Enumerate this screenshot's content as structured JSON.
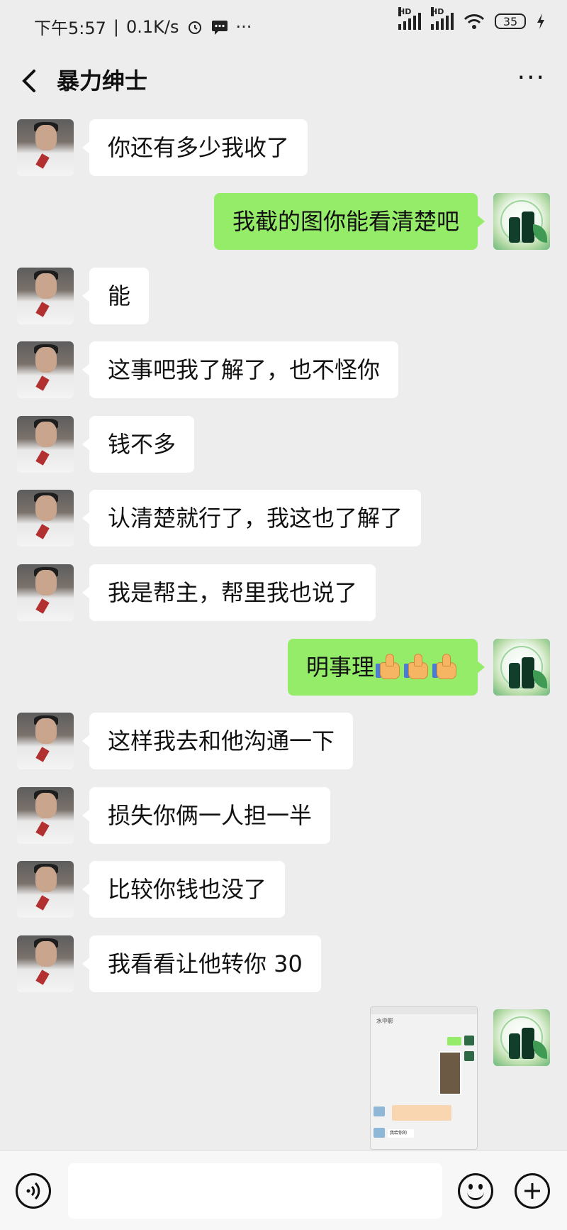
{
  "status_bar": {
    "time": "下午5:57",
    "speed": "0.1K/s",
    "more": "···",
    "network_label": "HD",
    "battery": "35"
  },
  "header": {
    "title": "暴力绅士",
    "more": "···"
  },
  "messages": [
    {
      "from": "them",
      "text": "你还有多少我收了"
    },
    {
      "from": "me",
      "text": "我截的图你能看清楚吧"
    },
    {
      "from": "them",
      "text": "能"
    },
    {
      "from": "them",
      "text": "这事吧我了解了，也不怪你"
    },
    {
      "from": "them",
      "text": "钱不多"
    },
    {
      "from": "them",
      "text": "认清楚就行了，我这也了解了"
    },
    {
      "from": "them",
      "text": "我是帮主，帮里我也说了"
    },
    {
      "from": "me",
      "text": "明事理",
      "emoji": "thumbs-up",
      "emoji_count": 3
    },
    {
      "from": "them",
      "text": "这样我去和他沟通一下"
    },
    {
      "from": "them",
      "text": "损失你俩一人担一半"
    },
    {
      "from": "them",
      "text": "比较你钱也没了"
    },
    {
      "from": "them",
      "text": "我看看让他转你 30"
    },
    {
      "from": "me",
      "type": "image",
      "description_icon": "screenshot-thumbnail"
    }
  ],
  "shot": {
    "header": "水中影",
    "tag": "我给你的"
  },
  "input": {
    "value": "",
    "placeholder": ""
  },
  "icons": {
    "back": "chevron-left-icon",
    "voice": "voice-icon",
    "emoji": "emoji-icon",
    "plus": "plus-icon"
  }
}
